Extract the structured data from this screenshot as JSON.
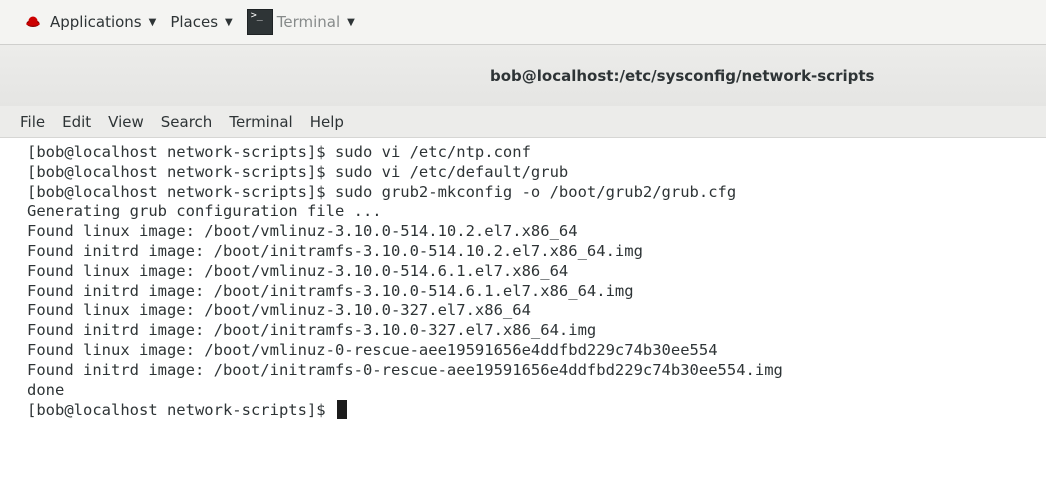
{
  "panel": {
    "applications_label": "Applications",
    "places_label": "Places",
    "terminal_label": "Terminal",
    "dropdown_glyph": "▼",
    "applications_icon": "redhat-logo-icon",
    "terminal_icon": "terminal-icon",
    "terminal_icon_glyph": ">_"
  },
  "window": {
    "title": "bob@localhost:/etc/sysconfig/network-scripts"
  },
  "menubar": {
    "items": [
      "File",
      "Edit",
      "View",
      "Search",
      "Terminal",
      "Help"
    ]
  },
  "terminal": {
    "lines": [
      "[bob@localhost network-scripts]$ sudo vi /etc/ntp.conf",
      "[bob@localhost network-scripts]$ sudo vi /etc/default/grub",
      "[bob@localhost network-scripts]$ sudo grub2-mkconfig -o /boot/grub2/grub.cfg",
      "Generating grub configuration file ...",
      "Found linux image: /boot/vmlinuz-3.10.0-514.10.2.el7.x86_64",
      "Found initrd image: /boot/initramfs-3.10.0-514.10.2.el7.x86_64.img",
      "Found linux image: /boot/vmlinuz-3.10.0-514.6.1.el7.x86_64",
      "Found initrd image: /boot/initramfs-3.10.0-514.6.1.el7.x86_64.img",
      "Found linux image: /boot/vmlinuz-3.10.0-327.el7.x86_64",
      "Found initrd image: /boot/initramfs-3.10.0-327.el7.x86_64.img",
      "Found linux image: /boot/vmlinuz-0-rescue-aee19591656e4ddfbd229c74b30ee554",
      "Found initrd image: /boot/initramfs-0-rescue-aee19591656e4ddfbd229c74b30ee554.img",
      "done"
    ],
    "prompt": "[bob@localhost network-scripts]$ "
  },
  "colors": {
    "panel_bg": "#f4f4f2",
    "titlebar_bg": "#e8e8e6",
    "text": "#2e3436",
    "terminal_bg": "#ffffff",
    "redhat_red": "#cc0000"
  }
}
